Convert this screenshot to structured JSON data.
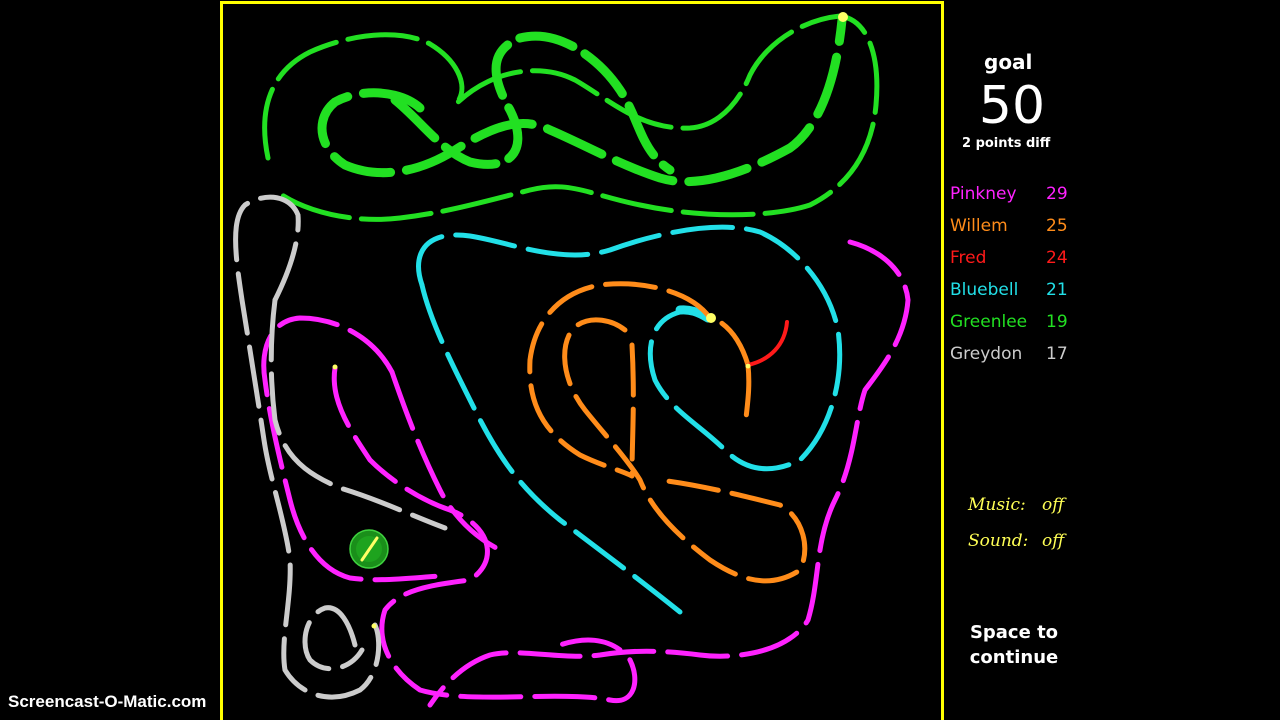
{
  "goal": {
    "label": "goal",
    "value": "50",
    "diff_text": "2 points diff"
  },
  "players": [
    {
      "name": "Pinkney",
      "score": "29",
      "color": "#ff22ff"
    },
    {
      "name": "Willem",
      "score": "25",
      "color": "#ff8c1a"
    },
    {
      "name": "Fred",
      "score": "24",
      "color": "#ff1a1a"
    },
    {
      "name": "Bluebell",
      "score": "21",
      "color": "#22e0e8"
    },
    {
      "name": "Greenlee",
      "score": "19",
      "color": "#22e022"
    },
    {
      "name": "Greydon",
      "score": "17",
      "color": "#cccccc"
    }
  ],
  "settings": {
    "music_label": "Music:",
    "music_value": "off",
    "sound_label": "Sound:",
    "sound_value": "off"
  },
  "prompt": {
    "line1": "Space to",
    "line2": "continue"
  },
  "watermark": "Screencast-O-Matic.com",
  "colors": {
    "border": "#ffff00",
    "background": "#000000",
    "head_dot": "#ffff66",
    "powerup": "#1e9a1e"
  }
}
